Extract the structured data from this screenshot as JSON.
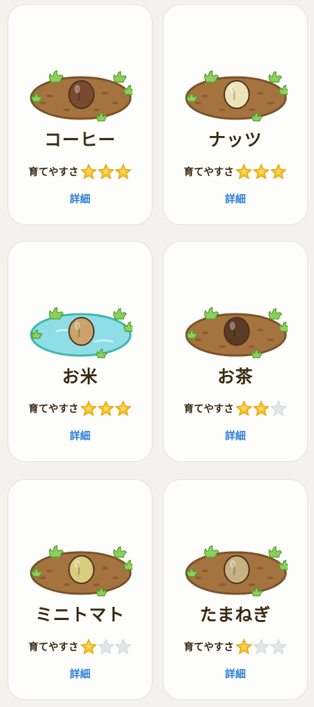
{
  "ease_label": "育てやすさ",
  "detail_label": "詳細",
  "colors": {
    "soil": "#a5733f",
    "soil_rim": "#7a5329",
    "water": "#8fdde6",
    "water_rim": "#3fb7a9",
    "star_on": "#f7c21d",
    "star_off": "#e3e5ea",
    "link": "#2f7fd8"
  },
  "crops": [
    {
      "name": "コーヒー",
      "rating": 3,
      "max": 3,
      "field": "soil",
      "seed": "coffee-bean-icon",
      "seed_color": "#7a4a30"
    },
    {
      "name": "ナッツ",
      "rating": 3,
      "max": 3,
      "field": "soil",
      "seed": "nut-seed-icon",
      "seed_color": "#ece3b8"
    },
    {
      "name": "お米",
      "rating": 3,
      "max": 3,
      "field": "water",
      "seed": "rice-seed-icon",
      "seed_color": "#c9a36a"
    },
    {
      "name": "お茶",
      "rating": 2,
      "max": 3,
      "field": "soil",
      "seed": "tea-seed-icon",
      "seed_color": "#5b3a26"
    },
    {
      "name": "ミニトマト",
      "rating": 1,
      "max": 3,
      "field": "soil",
      "seed": "tomato-seed-icon",
      "seed_color": "#d9cc7e"
    },
    {
      "name": "たまねぎ",
      "rating": 1,
      "max": 3,
      "field": "soil",
      "seed": "onion-seed-icon",
      "seed_color": "#c8b183"
    }
  ]
}
